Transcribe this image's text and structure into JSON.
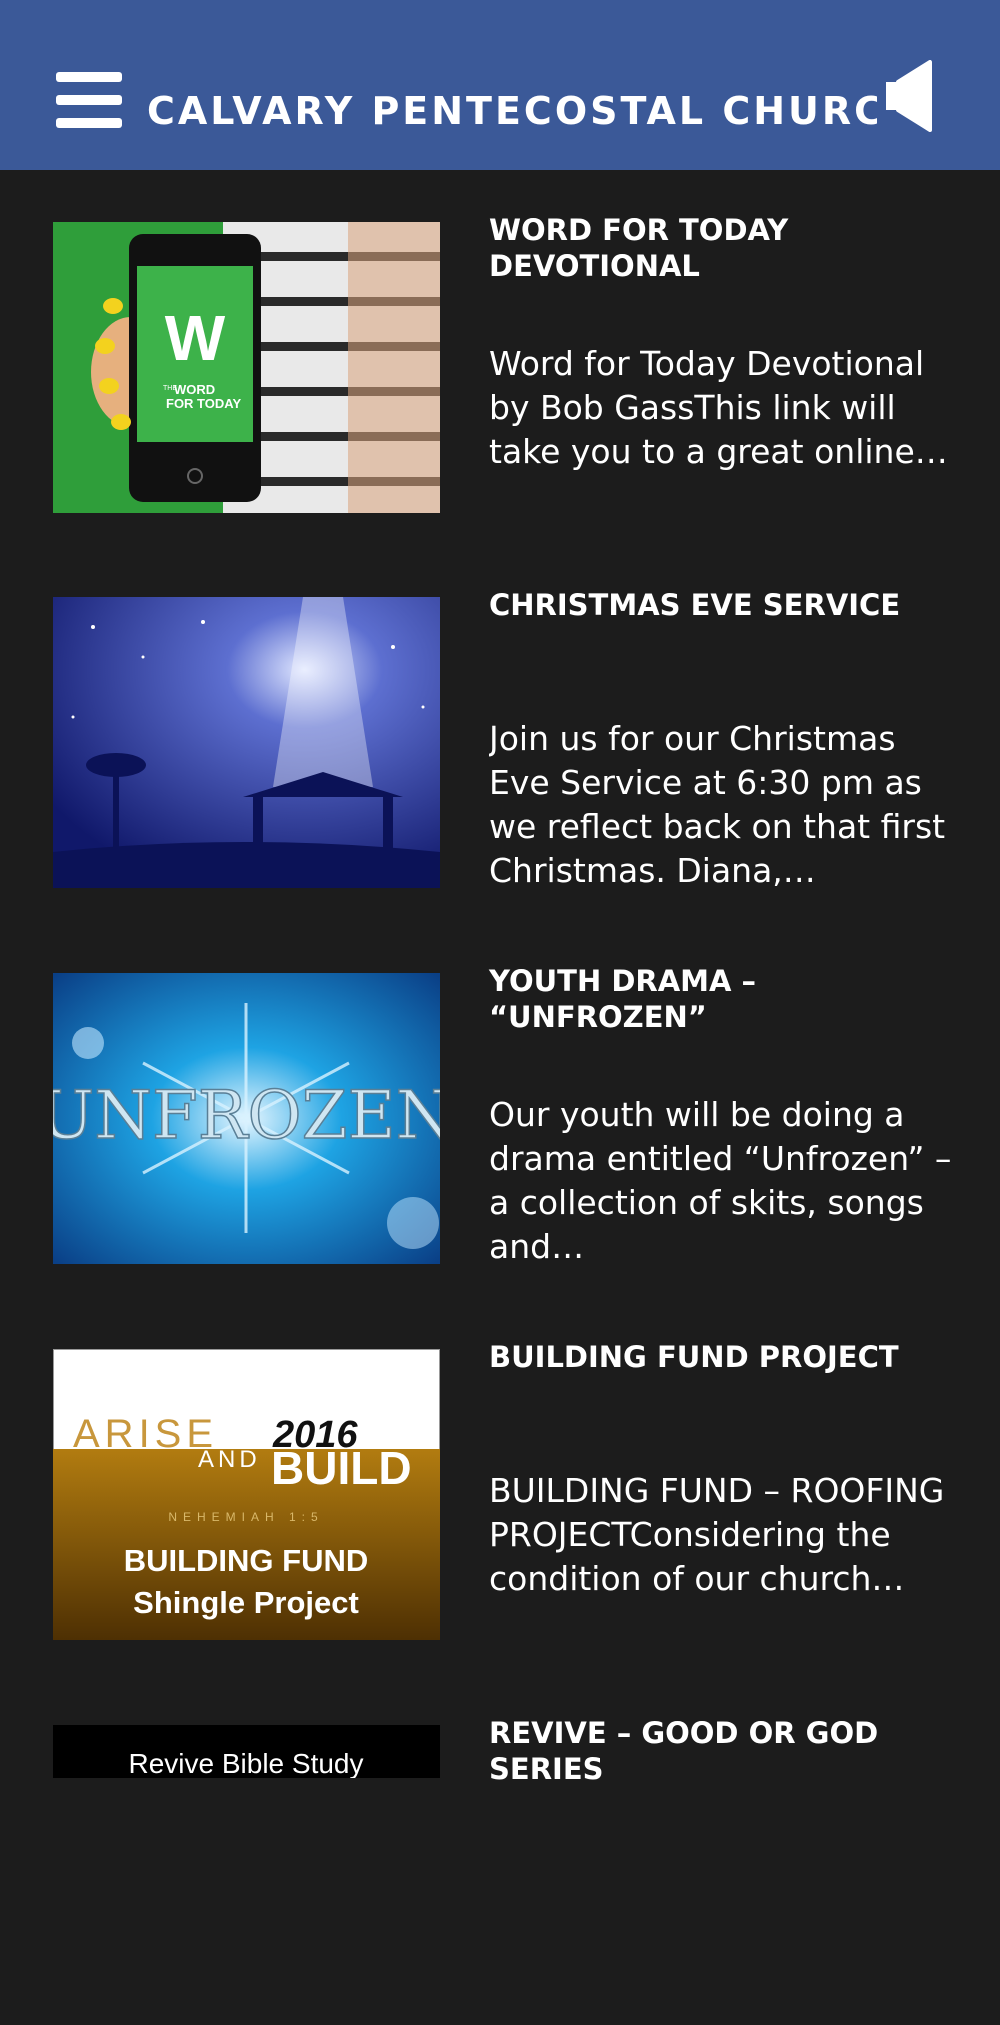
{
  "header": {
    "title": "CALVARY PENTECOSTAL CHURCH",
    "menu_icon": "hamburger-menu-icon",
    "speaker_icon": "speaker-icon",
    "background": "#3b5998"
  },
  "posts": [
    {
      "title": "WORD FOR TODAY DEVOTIONAL",
      "excerpt": "Word for Today Devotional by Bob GassThis link will take you to a great online…",
      "image_text_1": "THE",
      "image_text_2": "WORD",
      "image_text_3": "FOR TODAY",
      "image_text_big": "W"
    },
    {
      "title": "CHRISTMAS EVE SERVICE",
      "excerpt": "Join us for our Christmas Eve Service at 6:30 pm as we reflect back on that first Christmas. Diana,…"
    },
    {
      "title": "YOUTH DRAMA – “UNFROZEN”",
      "excerpt": "Our youth will be doing a drama entitled  “Unfrozen” – a collection of skits, songs and…",
      "image_text": "UNFROZEN"
    },
    {
      "title": "BUILDING FUND PROJECT",
      "excerpt": "BUILDING FUND – ROOFING PROJECTConsidering the condition of our church…",
      "image_text_arise": "ARISE",
      "image_text_and": "AND",
      "image_text_year": "2016",
      "image_text_build": "BUILD",
      "image_text_ref": "NEHEMIAH 1:5",
      "image_text_fund": "BUILDING FUND",
      "image_text_shingle": "Shingle Project"
    },
    {
      "title": "REVIVE – GOOD OR GOD SERIES",
      "image_text": "Revive Bible Study"
    }
  ]
}
